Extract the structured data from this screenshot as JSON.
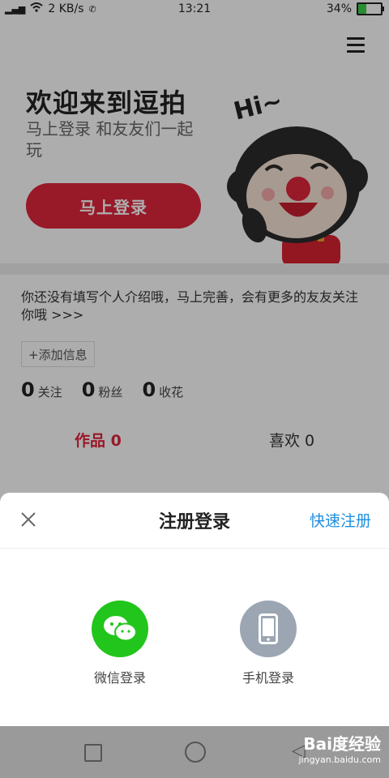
{
  "status_bar": {
    "network_speed": "2 KB/s",
    "time": "13:21",
    "battery": "34%",
    "battery_level": 0.34
  },
  "profile": {
    "welcome_title": "欢迎来到逗拍",
    "welcome_subtitle": "马上登录 和友友们一起玩",
    "login_button": "马上登录",
    "mascot_greeting": "Hi~",
    "intro_prompt": "你还没有填写个人介绍哦，马上完善，会有更多的友友关注你哦 >>>",
    "add_info_button": "+添加信息",
    "stats": [
      {
        "count": "0",
        "label": "关注"
      },
      {
        "count": "0",
        "label": "粉丝"
      },
      {
        "count": "0",
        "label": "收花"
      }
    ],
    "tabs": {
      "works": "作品 0",
      "likes": "喜欢 0"
    }
  },
  "login_sheet": {
    "title": "注册登录",
    "quick_register": "快速注册",
    "options": [
      {
        "label": "微信登录",
        "icon": "wechat-icon",
        "color": "#22c51b"
      },
      {
        "label": "手机登录",
        "icon": "phone-icon",
        "color": "#9ba6b2"
      }
    ]
  },
  "watermark": {
    "logo": "Bai度经验",
    "url": "jingyan.baidu.com"
  },
  "colors": {
    "accent_red": "#e0253c",
    "link_blue": "#1e8fe0"
  }
}
